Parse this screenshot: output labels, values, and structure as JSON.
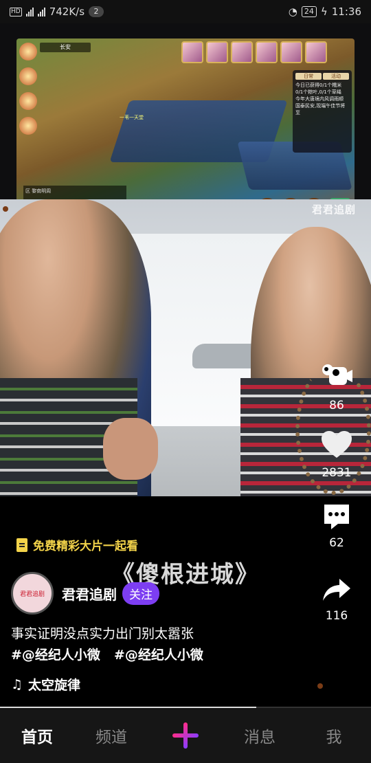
{
  "status_bar": {
    "network_speed": "742K/s",
    "notification_count": "2",
    "battery": "24",
    "time": "11:36",
    "signal_labels": [
      "4G",
      "4G"
    ]
  },
  "game": {
    "location": "长安",
    "panel_tabs": [
      "日常",
      "活动"
    ],
    "panel_lines": [
      "今日已获得0/1个糯米",
      "0/1个粽叶,0/1个草绳",
      "今年大唐境内风调雨顺",
      "国泰民安,现端午佳节将至"
    ],
    "hero_name": "一苇一天堂",
    "chat_text": "区 黎南明周 "
  },
  "video": {
    "watermark": "君君追剧",
    "drama_title": "《傻根进城》"
  },
  "actions": {
    "camera_count": "86",
    "like_count": "2831",
    "comment_count": "62",
    "share_count": "116"
  },
  "promo": {
    "text": "免费精彩大片一起看"
  },
  "author": {
    "name": "君君追剧",
    "follow_label": "关注",
    "avatar_text": "君君追剧"
  },
  "post": {
    "description": "事实证明没点实力出门别太嚣张",
    "tags": [
      "#@经纪人小微",
      "#@经纪人小微"
    ],
    "music_icon": "♫",
    "music": "太空旋律"
  },
  "progress": 0.69,
  "nav": {
    "home": "首页",
    "channel": "频道",
    "messages": "消息",
    "me": "我"
  },
  "colors": {
    "accent": "#7d3ef2",
    "promo": "#f3d34a",
    "plus_start": "#ff2d8a",
    "plus_end": "#8a3cff"
  }
}
